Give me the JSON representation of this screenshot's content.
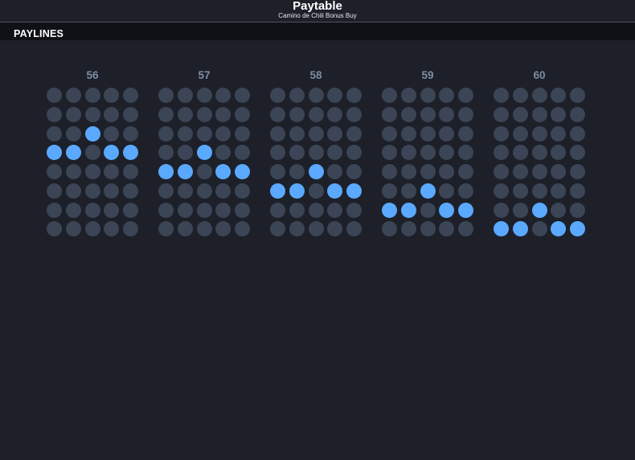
{
  "header": {
    "title": "Paytable",
    "subtitle": "Camino de Chili Bonus Buy"
  },
  "section": {
    "label": "PAYLINES"
  },
  "grid": {
    "rows": 8,
    "cols": 5
  },
  "colors": {
    "active": "#5aa9ff",
    "inactive": "#3b4555",
    "number": "#7e8da5",
    "background": "#1d2029",
    "bar": "#0f1116"
  },
  "paylines": [
    {
      "number": "56",
      "rows": [
        3,
        3,
        2,
        3,
        3
      ]
    },
    {
      "number": "57",
      "rows": [
        4,
        4,
        3,
        4,
        4
      ]
    },
    {
      "number": "58",
      "rows": [
        5,
        5,
        4,
        5,
        5
      ]
    },
    {
      "number": "59",
      "rows": [
        6,
        6,
        5,
        6,
        6
      ]
    },
    {
      "number": "60",
      "rows": [
        7,
        7,
        6,
        7,
        7
      ]
    }
  ]
}
